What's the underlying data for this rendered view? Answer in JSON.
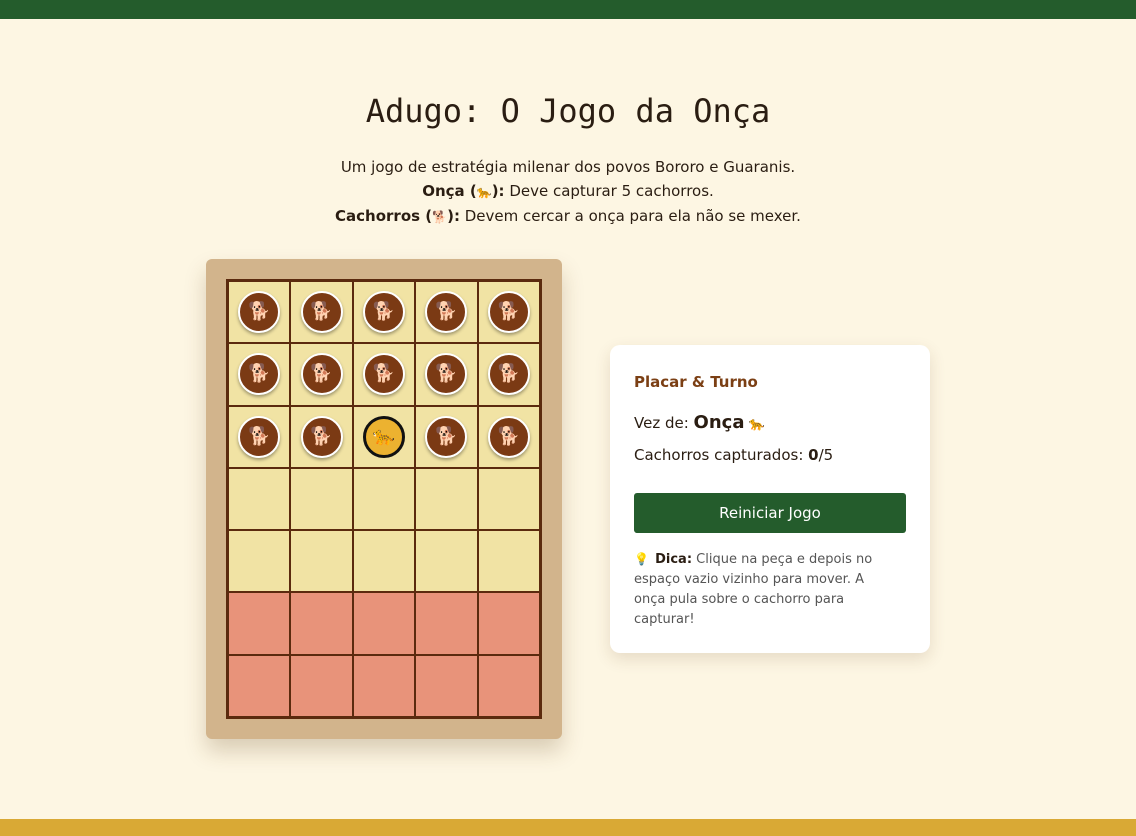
{
  "header": {
    "title": "Adugo: O Jogo da Onça",
    "intro_line1": "Um jogo de estratégia milenar dos povos Bororo e Guaranis.",
    "jaguar_label": "Onça (",
    "jaguar_icon": "🐆",
    "jaguar_label_end": "):",
    "jaguar_desc": " Deve capturar 5 cachorros.",
    "dogs_label": "Cachorros (",
    "dogs_icon": "🐕",
    "dogs_label_end": "):",
    "dogs_desc": " Devem cercar a onça para ela não se mexer."
  },
  "board": {
    "rows": [
      [
        "dog",
        "dog",
        "dog",
        "dog",
        "dog"
      ],
      [
        "dog",
        "dog",
        "dog",
        "dog",
        "dog"
      ],
      [
        "dog",
        "dog",
        "jaguar",
        "dog",
        "dog"
      ],
      [
        "",
        "",
        "",
        "",
        ""
      ],
      [
        "",
        "",
        "",
        "",
        ""
      ],
      [
        "",
        "",
        "",
        "",
        ""
      ],
      [
        "",
        "",
        "",
        "",
        ""
      ]
    ],
    "zone_rows": [
      5,
      6
    ],
    "dog_icon": "🐕",
    "jaguar_icon": "🐆",
    "colors": {
      "cell": "#f1e3a4",
      "zone_cell": "#e8937a",
      "lines": "#5b2a0e",
      "frame": "#d2b48c",
      "dog_piece": "#7b3a14",
      "jaguar_piece": "#ecb230"
    }
  },
  "panel": {
    "title": "Placar & Turno",
    "turn_label": "Vez de: ",
    "turn_value": "Onça",
    "turn_icon": "🐆",
    "captured_label": "Cachorros capturados: ",
    "captured_value": "0",
    "captured_total": "/5",
    "reset_label": "Reiniciar Jogo",
    "tip_icon": "💡",
    "tip_label": "Dica:",
    "tip_text": " Clique na peça e depois no espaço vazio vizinho para mover. A onça pula sobre o cachorro para capturar!"
  },
  "colors": {
    "top_bar": "#245c2c",
    "bottom_bar": "#d9a935",
    "background": "#fdf6e3",
    "button": "#245c2c",
    "panel_title": "#7b3f14"
  }
}
